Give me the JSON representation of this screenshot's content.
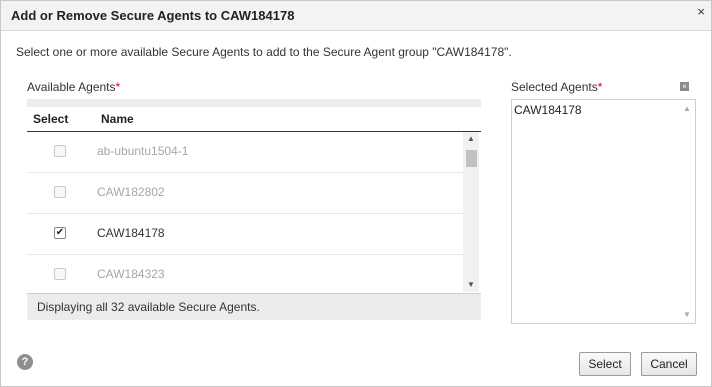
{
  "dialog": {
    "title": "Add or Remove Secure Agents to CAW184178",
    "close_glyph": "×",
    "instructions": "Select one or more available Secure Agents to add to the Secure Agent group \"CAW184178\"."
  },
  "available": {
    "label": "Available Agents",
    "required_mark": "*",
    "columns": {
      "select": "Select",
      "name": "Name"
    },
    "rows": [
      {
        "name": "ab-ubuntu1504-1",
        "checked": false,
        "enabled": false
      },
      {
        "name": "CAW182802",
        "checked": false,
        "enabled": false
      },
      {
        "name": "CAW184178",
        "checked": true,
        "enabled": true
      },
      {
        "name": "CAW184323",
        "checked": false,
        "enabled": false
      }
    ],
    "status": "Displaying all 32 available Secure Agents."
  },
  "selected": {
    "label": "Selected Agents",
    "required_mark": "*",
    "clear_glyph": "×",
    "items": [
      "CAW184178"
    ]
  },
  "footer": {
    "help_glyph": "?",
    "select_label": "Select",
    "cancel_label": "Cancel"
  },
  "icons": {
    "close": "close-icon",
    "help": "help-icon",
    "clear": "clear-icon",
    "check": "checkmark-icon"
  }
}
